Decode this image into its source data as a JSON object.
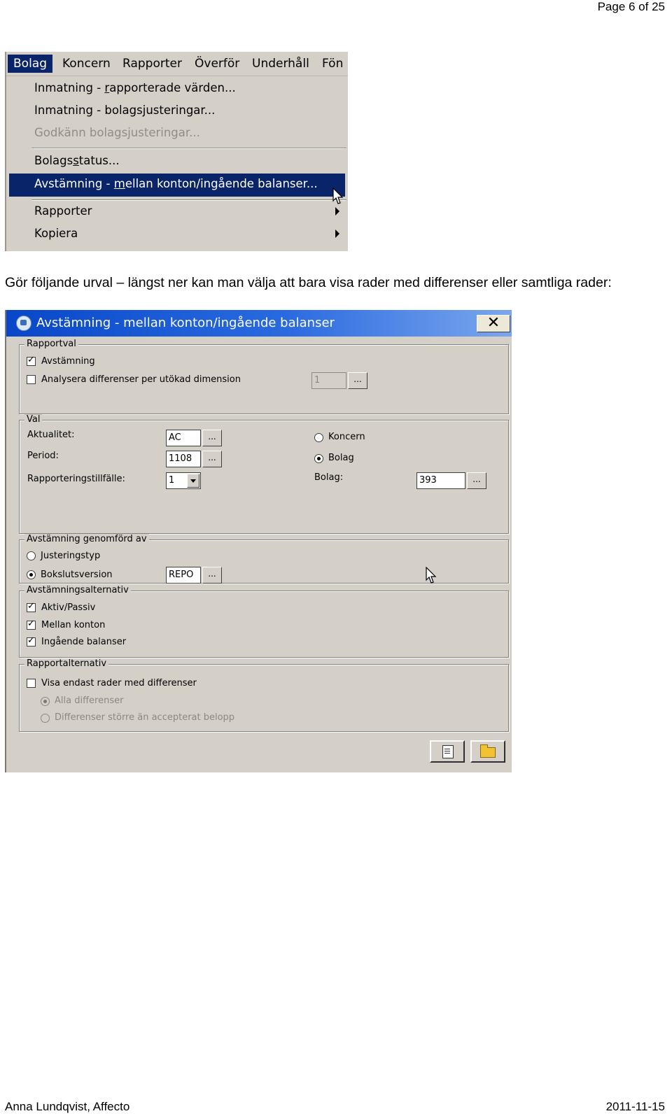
{
  "header": {
    "page_number": "Page 6 of 25"
  },
  "menu_screenshot": {
    "menubar": [
      "Bolag",
      "Koncern",
      "Rapporter",
      "Överför",
      "Underhåll",
      "Fön"
    ],
    "active_menu": "Bolag",
    "items": {
      "item1_pre": "Inmatning - ",
      "item1_u": "r",
      "item1_post": "apporterade värden...",
      "item2_pre": "Inmatning - bolags",
      "item2_u": "j",
      "item2_post": "usteringar...",
      "item3": "Godkänn bolagsjusteringar...",
      "item4_pre": "Bolags",
      "item4_u": "s",
      "item4_post": "tatus...",
      "item5_pre": "Avstämning - ",
      "item5_u": "m",
      "item5_post": "ellan konton/ingående balanser...",
      "item6": "Rapporter",
      "item7": "Kopiera"
    }
  },
  "instruction": "Gör följande urval – längst ner kan man välja att bara visa rader med differenser eller samtliga rader:",
  "dialog": {
    "title": "Avstämning - mellan konton/ingående balanser",
    "close_symbol": "✕",
    "rapportval": {
      "label": "Rapportval",
      "avstamning": "Avstämning",
      "analysera": "Analysera differenser per utökad dimension",
      "dimension_value": "1",
      "browse": "..."
    },
    "val": {
      "label": "Val",
      "aktualitet_label": "Aktualitet:",
      "aktualitet_value": "AC",
      "period_label": "Period:",
      "period_value": "1108",
      "rapporteringstillfalle_label": "Rapporteringstillfälle:",
      "rapporteringstillfalle_value": "1",
      "koncern": "Koncern",
      "bolag": "Bolag",
      "bolag_label": "Bolag:",
      "bolag_value": "393",
      "browse": "..."
    },
    "genomford": {
      "label": "Avstämning genomförd av",
      "justeringstyp": "Justeringstyp",
      "bokslutsversion": "Bokslutsversion",
      "bokslutsversion_value": "REPO",
      "browse": "..."
    },
    "alternativ": {
      "label": "Avstämningsalternativ",
      "aktiv_passiv": "Aktiv/Passiv",
      "mellan_konton": "Mellan konton",
      "ingaende_balanser": "Ingående balanser"
    },
    "rapportalternativ": {
      "label": "Rapportalternativ",
      "visa_endast": "Visa endast rader med differenser",
      "alla_differenser": "Alla differenser",
      "storre_an": "Differenser större än accepterat belopp"
    }
  },
  "footer": {
    "author": "Anna Lundqvist, Affecto",
    "date": "2011-11-15"
  }
}
